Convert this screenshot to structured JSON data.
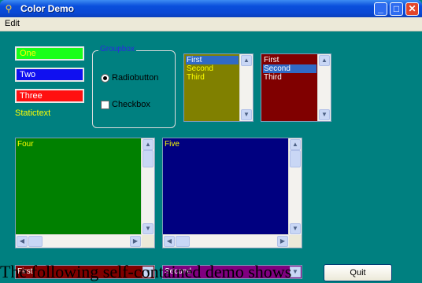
{
  "window": {
    "title": "Color Demo",
    "icon": "app-icon"
  },
  "menu": {
    "items": [
      "Edit"
    ]
  },
  "edits": {
    "one": "One",
    "two": "Two",
    "three": "Three"
  },
  "static_text": "Statictext",
  "groupbox": {
    "label": "Groupbox",
    "radio_label": "Radiobutton",
    "checkbox_label": "Checkbox"
  },
  "listbox1": {
    "items": [
      "First",
      "Second",
      "Third"
    ],
    "selected": "First"
  },
  "listbox2": {
    "items": [
      "First",
      "Second",
      "Third"
    ],
    "selected": "Second"
  },
  "textareas": {
    "four": "Four",
    "five": "Five"
  },
  "combos": {
    "first": "First",
    "second": "Second"
  },
  "quit_label": "Quit",
  "overlay_text": "The following self-contained demo shows",
  "colors": {
    "background": "#008080",
    "edit_one": "#19ff19",
    "edit_two": "#1010f0",
    "edit_three": "#ff1010",
    "static_text": "#ffff00",
    "groupbox_label": "#2a2ae0",
    "listbox1_bg": "#808000",
    "listbox2_bg": "#800000",
    "textarea_four_bg": "#008000",
    "textarea_five_bg": "#000080",
    "combo1_bg": "#800000",
    "combo2_bg": "#800080"
  }
}
